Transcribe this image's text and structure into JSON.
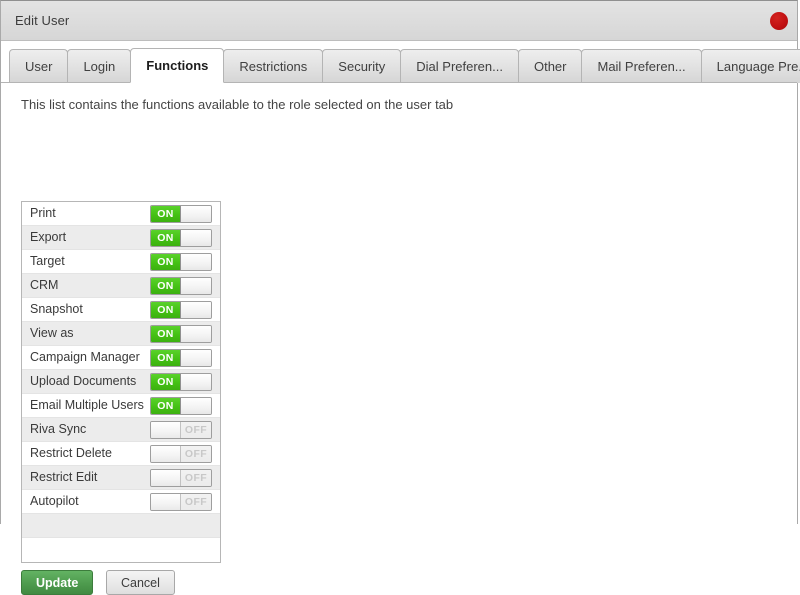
{
  "window": {
    "title": "Edit User",
    "close_icon": "close-dot-icon",
    "close_color": "#c21012"
  },
  "tabs": [
    {
      "label": "User",
      "active": false
    },
    {
      "label": "Login",
      "active": false
    },
    {
      "label": "Functions",
      "active": true
    },
    {
      "label": "Restrictions",
      "active": false
    },
    {
      "label": "Security",
      "active": false
    },
    {
      "label": "Dial Preferen...",
      "active": false
    },
    {
      "label": "Other",
      "active": false
    },
    {
      "label": "Mail Preferen...",
      "active": false
    },
    {
      "label": "Language Pre...",
      "active": false
    }
  ],
  "panel": {
    "hint": "This list contains the functions available to the role selected on the user tab"
  },
  "functions": {
    "on_label": "ON",
    "off_label": "OFF",
    "on_color": "#44c115",
    "off_color": "#c8c8c8",
    "items": [
      {
        "label": "Print",
        "state": "on"
      },
      {
        "label": "Export",
        "state": "on"
      },
      {
        "label": "Target",
        "state": "on"
      },
      {
        "label": "CRM",
        "state": "on"
      },
      {
        "label": "Snapshot",
        "state": "on"
      },
      {
        "label": "View as",
        "state": "on"
      },
      {
        "label": "Campaign Manager",
        "state": "on"
      },
      {
        "label": "Upload Documents",
        "state": "on"
      },
      {
        "label": "Email Multiple Users",
        "state": "on"
      },
      {
        "label": "Riva Sync",
        "state": "off"
      },
      {
        "label": "Restrict Delete",
        "state": "off"
      },
      {
        "label": "Restrict Edit",
        "state": "off"
      },
      {
        "label": "Autopilot",
        "state": "off"
      },
      {
        "label": "",
        "state": "none"
      },
      {
        "label": "",
        "state": "none"
      }
    ]
  },
  "footer": {
    "update_label": "Update",
    "cancel_label": "Cancel"
  }
}
